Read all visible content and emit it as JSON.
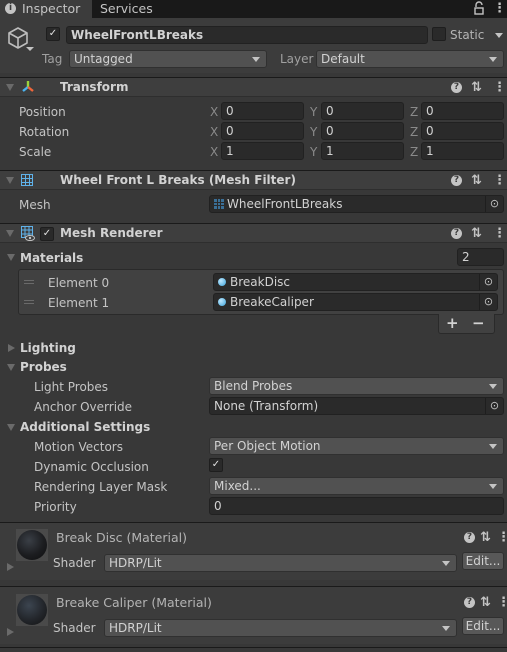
{
  "tabs": [
    {
      "label": "Inspector",
      "active": true
    },
    {
      "label": "Services",
      "active": false
    }
  ],
  "object": {
    "active": true,
    "name": "WheelFrontLBreaks",
    "static_label": "Static",
    "static_checked": false,
    "tag_label": "Tag",
    "tag_value": "Untagged",
    "layer_label": "Layer",
    "layer_value": "Default"
  },
  "transform": {
    "title": "Transform",
    "rows": [
      {
        "label": "Position",
        "x": "0",
        "y": "0",
        "z": "0"
      },
      {
        "label": "Rotation",
        "x": "0",
        "y": "0",
        "z": "0"
      },
      {
        "label": "Scale",
        "x": "1",
        "y": "1",
        "z": "1"
      }
    ],
    "axis_labels": [
      "X",
      "Y",
      "Z"
    ]
  },
  "mesh_filter": {
    "title": "Wheel Front L Breaks (Mesh Filter)",
    "mesh_label": "Mesh",
    "mesh_value": "WheelFrontLBreaks"
  },
  "mesh_renderer": {
    "title": "Mesh Renderer",
    "enabled": true,
    "materials_label": "Materials",
    "materials_count": "2",
    "elements": [
      {
        "label": "Element 0",
        "value": "BreakDisc"
      },
      {
        "label": "Element 1",
        "value": "BreakeCaliper"
      }
    ],
    "add_label": "+",
    "remove_label": "−",
    "lighting_label": "Lighting",
    "probes_label": "Probes",
    "light_probes_label": "Light Probes",
    "light_probes_value": "Blend Probes",
    "anchor_override_label": "Anchor Override",
    "anchor_override_value": "None (Transform)",
    "additional_label": "Additional Settings",
    "motion_vectors_label": "Motion Vectors",
    "motion_vectors_value": "Per Object Motion",
    "dynamic_occlusion_label": "Dynamic Occlusion",
    "dynamic_occlusion_checked": true,
    "rendering_layer_mask_label": "Rendering Layer Mask",
    "rendering_layer_mask_value": "Mixed...",
    "priority_label": "Priority",
    "priority_value": "0"
  },
  "materials": [
    {
      "title": "Break Disc (Material)",
      "shader_label": "Shader",
      "shader_value": "HDRP/Lit",
      "edit_label": "Edit..."
    },
    {
      "title": "Breake Caliper (Material)",
      "shader_label": "Shader",
      "shader_value": "HDRP/Lit",
      "edit_label": "Edit..."
    }
  ],
  "icons": {
    "check": "✓",
    "help": "?",
    "presets": "⇅",
    "menu": "⋮",
    "lock": "🔓",
    "picker": "⊙"
  },
  "colors": {
    "background": "#383838",
    "tab_bar": "#191919",
    "field": "#2a2a2a",
    "dropdown": "#515151",
    "accent": "#3aa2d8"
  }
}
